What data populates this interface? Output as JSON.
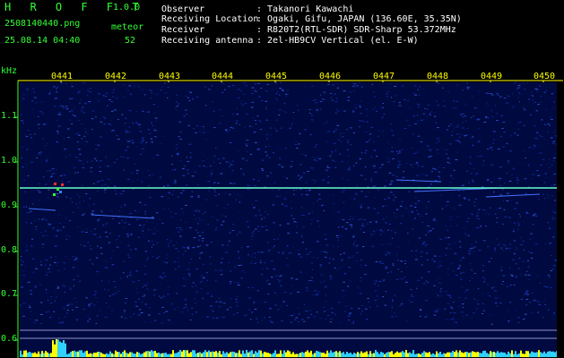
{
  "header": {
    "app_title": "H R O F F T",
    "version": "1.0.0",
    "filename": "2508140440.png",
    "datetime": "25.08.14 04:40",
    "meteor_label": "meteor",
    "meteor_count": "52"
  },
  "info": [
    {
      "label": "Observer",
      "value": ": Takanori Kawachi"
    },
    {
      "label": "Receiving Location",
      "value": ": Ogaki, Gifu, JAPAN (136.60E, 35.35N)"
    },
    {
      "label": "Receiver",
      "value": ": R820T2(RTL-SDR) SDR-Sharp 53.372MHz"
    },
    {
      "label": "Receiving antenna",
      "value": ": 2el-HB9CV Vertical (el. E-W)"
    }
  ],
  "axis": {
    "y_unit": "kHz",
    "y_ticks": [
      "1.1",
      "1.0",
      "0.9",
      "0.8",
      "0.7",
      "0.6"
    ],
    "x_ticks": [
      "0441",
      "0442",
      "0443",
      "0444",
      "0445",
      "0446",
      "0447",
      "0448",
      "0449",
      "0450"
    ]
  },
  "colors": {
    "background": "#000000",
    "plot_bg": "#000a40",
    "header_green": "#33ff33",
    "tick_yellow": "#ffff00",
    "carrier": "#66ffcc"
  }
}
